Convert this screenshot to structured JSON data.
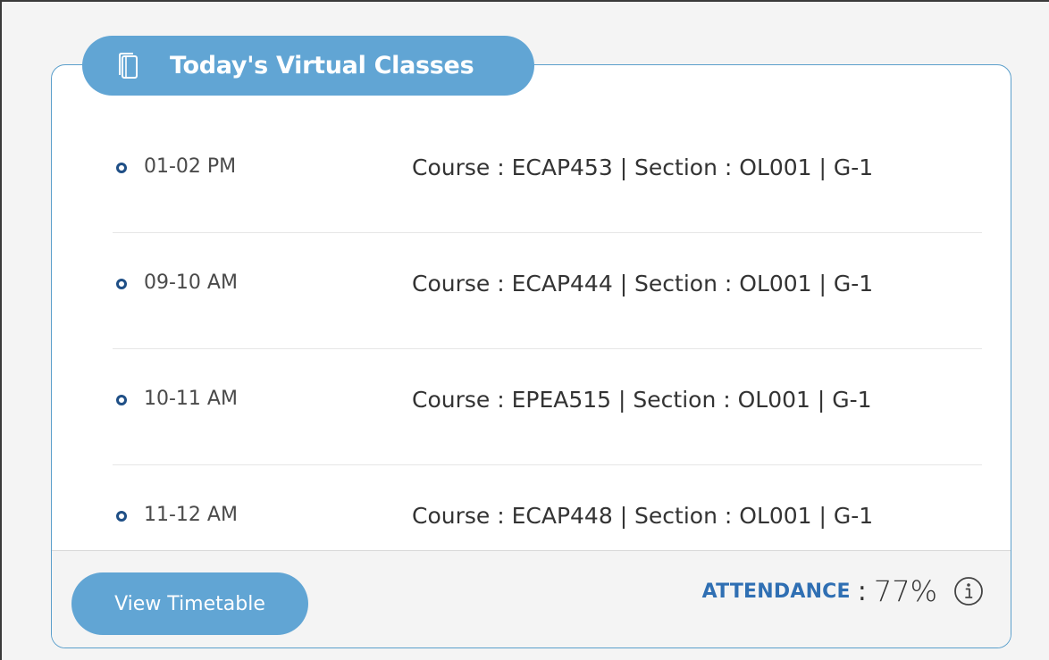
{
  "widget": {
    "title": "Today's Virtual Classes",
    "icon": "book-stack-icon"
  },
  "classes": [
    {
      "time": "01-02 PM",
      "course": "Course : ECAP453 | Section : OL001 | G-1"
    },
    {
      "time": "09-10 AM",
      "course": "Course : ECAP444 | Section : OL001 | G-1"
    },
    {
      "time": "10-11 AM",
      "course": "Course : EPEA515 | Section : OL001 | G-1"
    },
    {
      "time": "11-12 AM",
      "course": "Course : ECAP448 | Section : OL001 | G-1"
    }
  ],
  "footer": {
    "view_timetable_label": "View Timetable",
    "attendance_label": "ATTENDANCE",
    "attendance_separator": ":",
    "attendance_value": "77%",
    "info_icon": "info-icon"
  },
  "colors": {
    "accent": "#61a5d4",
    "bullet": "#1f4f86",
    "attendance_label": "#2f6fb3",
    "border": "#5b9fcb"
  }
}
